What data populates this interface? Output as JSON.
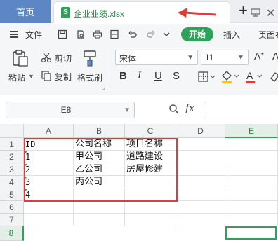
{
  "tabs": {
    "home": "首页",
    "file": "企业业绩.xlsx",
    "file_icon_letter": "S"
  },
  "menu": {
    "file": "文件",
    "start": "开始",
    "insert": "插入",
    "page_layout": "页面布"
  },
  "ribbon": {
    "paste": "粘贴",
    "cut": "剪切",
    "copy": "复制",
    "format_painter": "格式刷",
    "font_name": "宋体",
    "font_size": "11",
    "bold": "B",
    "italic": "I",
    "underline": "U",
    "strike": "S"
  },
  "formula_bar": {
    "cell_ref": "E8",
    "fx": "fx",
    "value": ""
  },
  "sheet": {
    "columns": [
      "A",
      "B",
      "C",
      "D",
      "E"
    ],
    "active_column": "E",
    "rows": [
      "1",
      "2",
      "3",
      "4",
      "5",
      "6",
      "7",
      "8"
    ],
    "active_row": "8",
    "cells": {
      "A1": "ID",
      "B1": "公司名称",
      "C1": "项目名称",
      "A2": "1",
      "B2": "甲公司",
      "C2": "道路建设",
      "A3": "2",
      "B3": "乙公司",
      "C3": "房屋修建",
      "A4": "3",
      "B4": "丙公司",
      "A5": "4"
    }
  },
  "colors": {
    "accent_green": "#2fa15b",
    "annotation_red": "#e23b3b",
    "home_tab_blue": "#5c87c4"
  }
}
